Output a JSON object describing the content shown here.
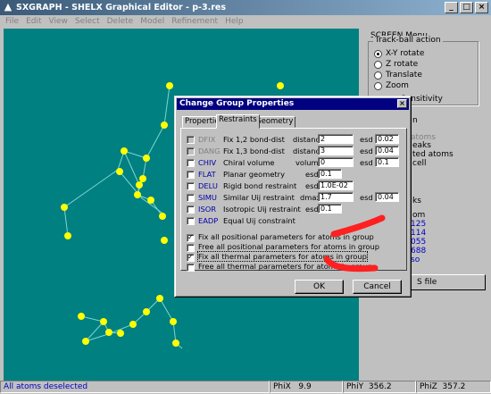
{
  "window": {
    "title": "SXGRAPH - SHELX Graphical Editor - p-3.res",
    "min": "_",
    "max": "□",
    "close": "×"
  },
  "menu": [
    "File",
    "Edit",
    "View",
    "Select",
    "Delete",
    "Model",
    "Refinement",
    "Help"
  ],
  "right_panel": {
    "title": "SCREEN Menu",
    "trackball": {
      "legend": "Track-ball action",
      "options": [
        {
          "label": "X-Y rotate",
          "selected": true
        },
        {
          "label": "Z rotate",
          "selected": false
        },
        {
          "label": "Translate",
          "selected": false
        },
        {
          "label": "Zoom",
          "selected": false
        }
      ],
      "sensitivity": "Sensitivity"
    },
    "partial_text": [
      "n",
      "atoms",
      "eaks",
      "ted atoms",
      "cell",
      "ks",
      "om"
    ],
    "partial_values": [
      "125",
      "114",
      "055",
      "688",
      "so"
    ],
    "s_file_button": "S file"
  },
  "status": {
    "message": "All atoms deselected",
    "phix_label": "PhiX",
    "phix": "9.9",
    "phiy_label": "PhiY",
    "phiy": "356.2",
    "phiz_label": "PhiZ",
    "phiz": "357.2"
  },
  "dialog": {
    "title": "Change Group Properties",
    "close": "×",
    "tabs": [
      {
        "label": "Properties",
        "active": false
      },
      {
        "label": "Restraints",
        "active": true
      },
      {
        "label": "Geometry",
        "active": false
      }
    ],
    "restraints": [
      {
        "code": "DFIX",
        "desc": "Fix 1,2 bond-dist",
        "enabled": false,
        "param_label": "distance",
        "param": "2",
        "esd_label": "esd",
        "esd": "0.02"
      },
      {
        "code": "DANG",
        "desc": "Fix 1,3 bond-dist",
        "enabled": false,
        "param_label": "distance",
        "param": "3",
        "esd_label": "esd",
        "esd": "0.04"
      },
      {
        "code": "CHIV",
        "desc": "Chiral volume",
        "enabled": true,
        "param_label": "volume",
        "param": "0",
        "esd_label": "esd",
        "esd": "0.1"
      },
      {
        "code": "FLAT",
        "desc": "Planar geometry",
        "enabled": true,
        "param_label": "esd",
        "param": "0.1"
      },
      {
        "code": "DELU",
        "desc": "Rigid bond restraint",
        "enabled": true,
        "param_label": "esd",
        "param": "1.0E-02"
      },
      {
        "code": "SIMU",
        "desc": "Similar Uij restraint",
        "enabled": true,
        "param_label": "dmax",
        "param": "1.7",
        "esd_label": "esd",
        "esd": "0.04"
      },
      {
        "code": "ISOR",
        "desc": "Isotropic Uij restraint",
        "enabled": true,
        "param_label": "esd",
        "param": "0.1"
      },
      {
        "code": "EADP",
        "desc": "Equal Uij constraint",
        "enabled": true
      }
    ],
    "options": [
      {
        "label": "Fix all positional parameters for atoms in group",
        "checked": true
      },
      {
        "label": "Free all positional parameters for atoms in group",
        "checked": false
      },
      {
        "label": "Fix all thermal parameters for atoms in group",
        "checked": true
      },
      {
        "label": "Free all thermal parameters for atoms in group",
        "checked": false
      }
    ],
    "ok": "OK",
    "cancel": "Cancel"
  },
  "colors": {
    "viewport": "#008080",
    "atom": "#ffff00",
    "bond": "#7fd4d4",
    "annotation": "#ff2020",
    "title_active": "#000080"
  }
}
